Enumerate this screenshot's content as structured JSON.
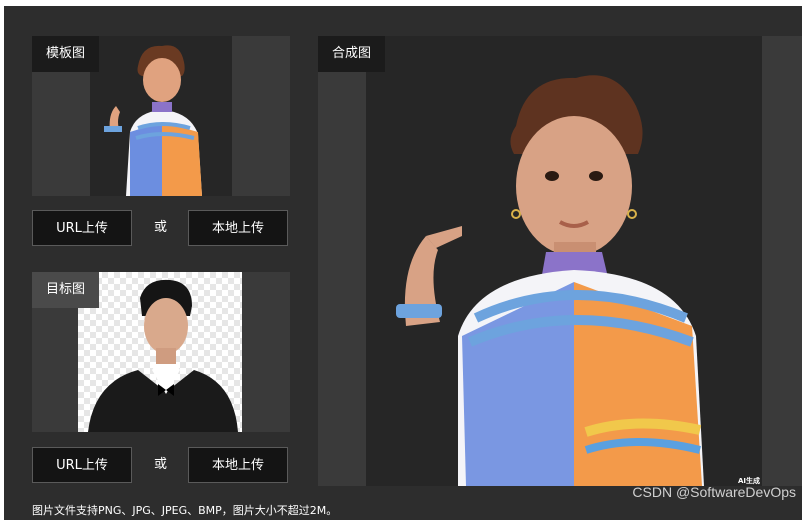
{
  "template_panel": {
    "label": "模板图",
    "url_upload": "URL上传",
    "or": "或",
    "local_upload": "本地上传"
  },
  "target_panel": {
    "label": "目标图",
    "url_upload": "URL上传",
    "or": "或",
    "local_upload": "本地上传"
  },
  "result_panel": {
    "label": "合成图",
    "ai_badge": "AI生成"
  },
  "hint_text": "图片文件支持PNG、JPG、JPEG、BMP，图片大小不超过2M。",
  "watermark": "CSDN @SoftwareDevOps",
  "colors": {
    "background": "#2d2d2d",
    "panel": "#3a3a3a",
    "label_bg": "#1b1b1b",
    "button_bg": "#141414"
  }
}
